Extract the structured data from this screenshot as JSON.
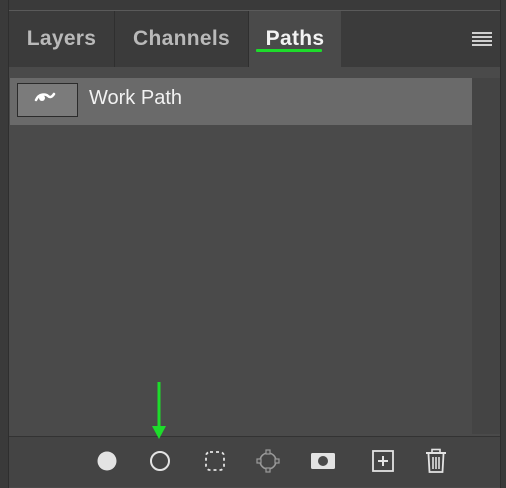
{
  "tabs": [
    {
      "label": "Layers",
      "active": false
    },
    {
      "label": "Channels",
      "active": false
    },
    {
      "label": "Paths",
      "active": true
    }
  ],
  "paths": [
    {
      "name": "Work Path",
      "selected": true
    }
  ],
  "toolbar": {
    "buttons": [
      "fill-path-icon",
      "stroke-path-icon",
      "load-path-as-selection-icon",
      "make-work-path-icon",
      "add-mask-icon",
      "create-new-path-icon",
      "delete-path-icon"
    ]
  },
  "colors": {
    "accent": "#1ddc2b",
    "panel": "#4a4a4a",
    "selected_row": "#6a6a6a"
  }
}
